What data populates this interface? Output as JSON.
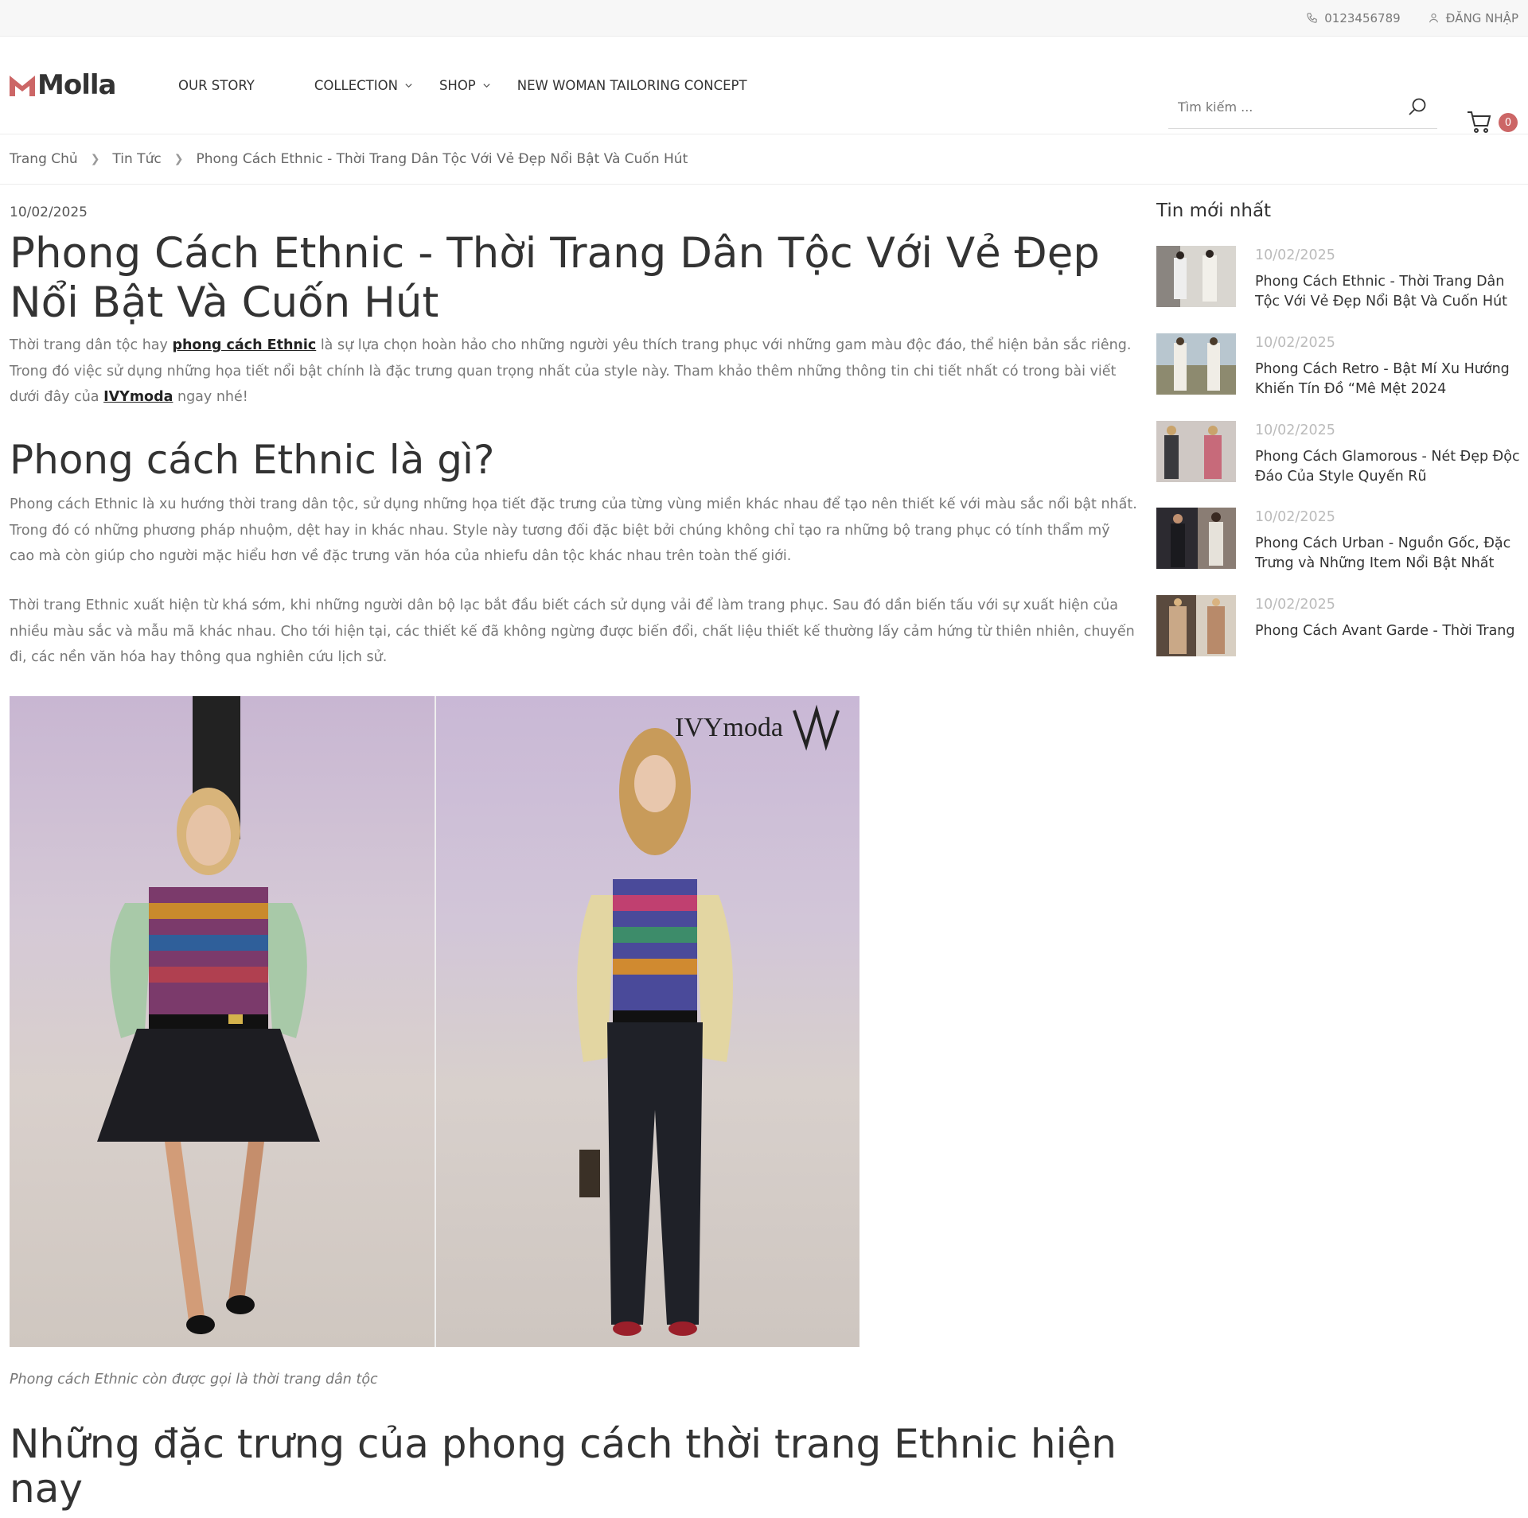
{
  "topbar": {
    "phone": "0123456789",
    "login": "ĐĂNG NHẬP"
  },
  "header": {
    "logo_text": "Molla",
    "nav": [
      "OUR STORY",
      "COLLECTION",
      "SHOP",
      "NEW WOMAN TAILORING CONCEPT"
    ],
    "search_placeholder": "Tìm kiếm ...",
    "cart_count": "0",
    "accent_color": "#cc6666"
  },
  "breadcrumb": [
    "Trang Chủ",
    "Tin Tức",
    "Phong Cách Ethnic - Thời Trang Dân Tộc Với Vẻ Đẹp Nổi Bật Và Cuốn Hút"
  ],
  "article": {
    "date": "10/02/2025",
    "title": "Phong Cách Ethnic - Thời Trang Dân Tộc Với Vẻ Đẹp Nổi Bật Và Cuốn Hút",
    "intro_before": "Thời trang dân tộc hay ",
    "intro_link1": "phong cách Ethnic",
    "intro_middle": " là sự lựa chọn hoàn hảo cho những người yêu thích trang phục với những gam màu độc đáo, thể hiện bản sắc riêng. Trong đó việc sử dụng những họa tiết nổi bật chính là đặc trưng quan trọng nhất của style này. Tham khảo thêm những thông tin chi tiết nhất có trong bài viết dưới đây của ",
    "intro_link2": "IVYmoda",
    "intro_after": " ngay nhé!",
    "h2_1": "Phong cách Ethnic là gì?",
    "p1": "Phong cách Ethnic là xu hướng thời trang dân tộc, sử dụng những họa tiết đặc trưng của từng vùng miền khác nhau để tạo nên thiết kế với màu sắc nổi bật nhất. Trong đó có những phương pháp nhuộm, dệt hay in khác nhau. Style này tương đối đặc biệt bởi chúng không chỉ tạo ra những bộ trang phục có tính thẩm mỹ cao mà còn giúp cho người mặc hiểu hơn về đặc trưng văn hóa của nhiefu dân tộc khác nhau trên toàn thế giới.",
    "p2": "Thời trang Ethnic xuất hiện từ khá sớm, khi những người dân bộ lạc bắt đầu biết cách sử dụng vải để làm trang phục. Sau đó dần biến tấu với sự xuất hiện của nhiều màu sắc và mẫu mã khác nhau. Cho tới hiện tại, các thiết kế đã không ngừng được biến đổi, chất liệu thiết kế thường lấy cảm hứng từ thiên nhiên, chuyến đi, các nền văn hóa hay thông qua nghiên cứu lịch sử.",
    "watermark": "IVYmoda",
    "caption": "Phong cách Ethnic còn được gọi là thời trang dân tộc",
    "h2_2": "Những đặc trưng của phong cách thời trang Ethnic hiện nay"
  },
  "sidebar": {
    "heading": "Tin mới nhất",
    "posts": [
      {
        "date": "10/02/2025",
        "title": "Phong Cách Ethnic - Thời Trang Dân Tộc Với Vẻ Đẹp Nổi Bật Và Cuốn Hút"
      },
      {
        "date": "10/02/2025",
        "title": "Phong Cách Retro - Bật Mí Xu Hướng Khiến Tín Đồ “Mê Mệt 2024"
      },
      {
        "date": "10/02/2025",
        "title": "Phong Cách Glamorous - Nét Đẹp Độc Đáo Của Style Quyến Rũ"
      },
      {
        "date": "10/02/2025",
        "title": "Phong Cách Urban - Nguồn Gốc, Đặc Trưng và Những Item Nổi Bật Nhất"
      },
      {
        "date": "10/02/2025",
        "title": "Phong Cách Avant Garde - Thời Trang"
      }
    ]
  }
}
